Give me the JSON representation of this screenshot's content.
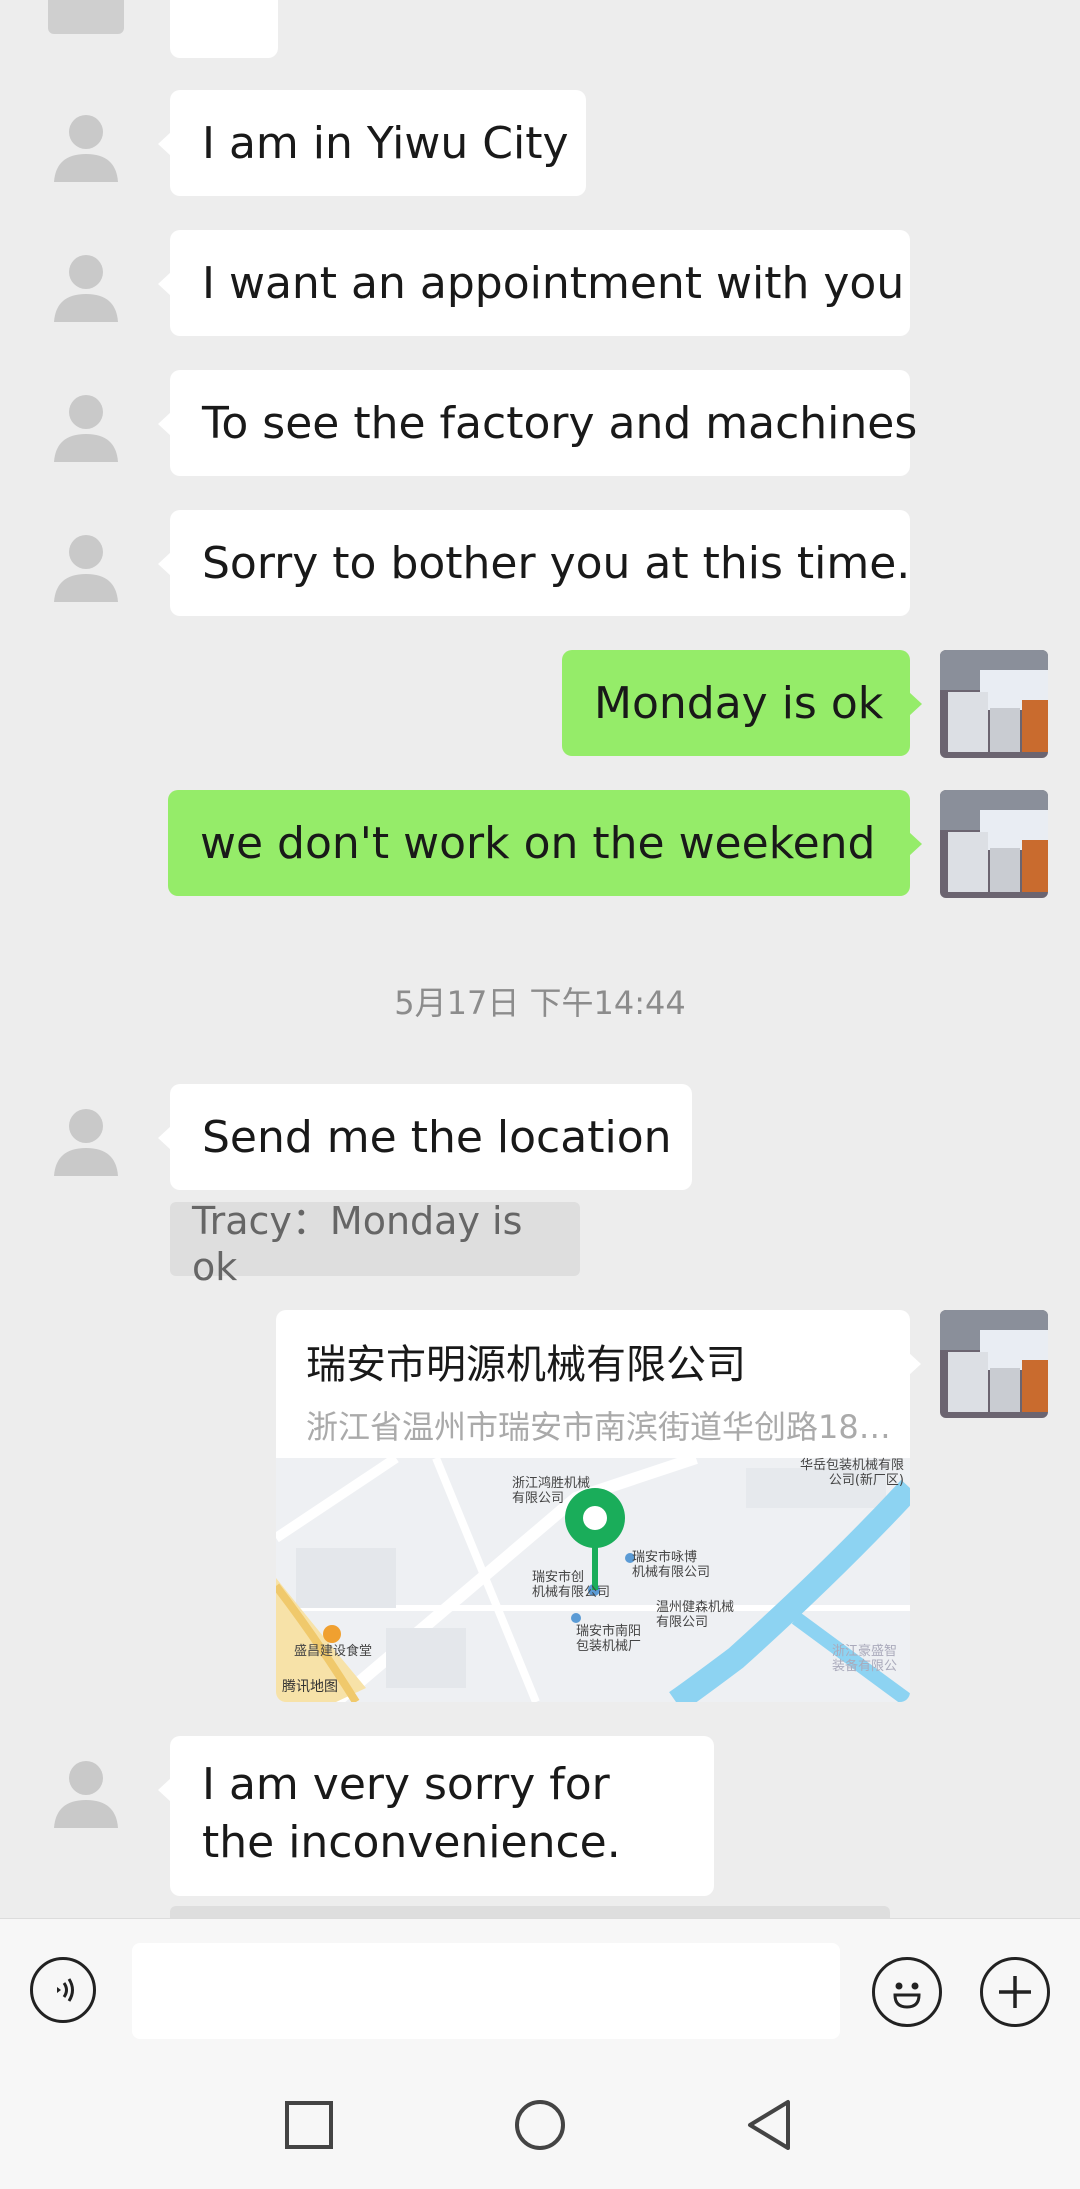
{
  "messages": [
    {
      "side": "left",
      "text": "I am in Yiwu City"
    },
    {
      "side": "left",
      "text": "I want an appointment with you"
    },
    {
      "side": "left",
      "text": "To see the factory and machines"
    },
    {
      "side": "left",
      "text": "Sorry to bother you at this time."
    },
    {
      "side": "right",
      "text": "Monday is ok"
    },
    {
      "side": "right",
      "text": "we don't work on the weekend"
    },
    {
      "side": "left",
      "text": "Send me the location"
    },
    {
      "side": "left",
      "text": "I am very sorry for the inconvenience."
    }
  ],
  "timestamp": "5月17日 下午14:44",
  "quote": "Tracy：Monday is ok",
  "location": {
    "title": "瑞安市明源机械有限公司",
    "address": "浙江省温州市瑞安市南滨街道华创路188...",
    "map_provider": "腾讯地图",
    "map_labels": {
      "l1": "浙江鸿胜机械",
      "l1b": "有限公司",
      "l2": "瑞安市创",
      "l2b": "机械有限公司",
      "l3": "瑞安市咏博",
      "l3b": "机械有限公司",
      "l4": "温州健森机械",
      "l4b": "有限公司",
      "l5": "瑞安市南阳",
      "l5b": "包装机械厂",
      "l6": "盛昌建设食堂",
      "l7": "华岳包装机械有限",
      "l7b": "公司(新厂区)",
      "l8": "浙江豪盛智",
      "l8b": "装备有限公"
    },
    "pin_color": "#1aad5a"
  },
  "colors": {
    "bg": "#ededed",
    "sent_bubble": "#95ec69",
    "recv_bubble": "#ffffff"
  }
}
